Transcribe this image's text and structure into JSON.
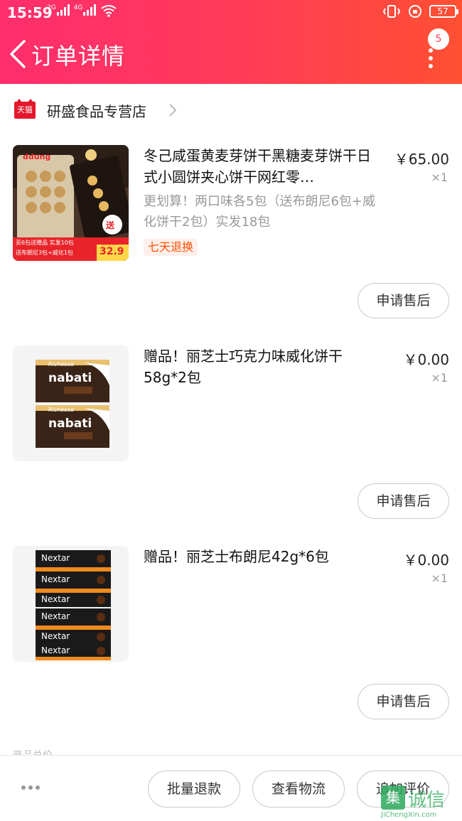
{
  "status_bar": {
    "time": "15:59",
    "signal_1": "2G",
    "signal_2": "4G",
    "battery": "57"
  },
  "header": {
    "title": "订单详情",
    "badge_count": "5"
  },
  "shop": {
    "name": "研盛食品专营店",
    "platform_logo_text": "天猫"
  },
  "items": [
    {
      "title": "冬己咸蛋黄麦芽饼干黑糖麦芽饼干日式小圆饼夹心饼干网红零…",
      "spec": "更划算！两口味各5包（送布朗尼6包+威化饼干2包）实发18包",
      "tag": "七天退换",
      "price": "￥65.00",
      "qty": "×1",
      "action": "申请售后",
      "thumb_text": {
        "brand": "ddung",
        "promo": "买6包送赠品 实发10包",
        "gift": "送布朗尼3包+威化1包",
        "price_label": "到手价:",
        "price": "32.9",
        "send": "送"
      }
    },
    {
      "title": "赠品！丽芝士巧克力味威化饼干58g*2包",
      "price": "￥0.00",
      "qty": "×1",
      "action": "申请售后",
      "thumb_text": {
        "brand": "Richeese",
        "product": "nabati"
      }
    },
    {
      "title": "赠品！丽芝士布朗尼42g*6包",
      "price": "￥0.00",
      "qty": "×1",
      "action": "申请售后",
      "thumb_text": {
        "product": "Nextar"
      }
    }
  ],
  "bottom_bar": {
    "peek_label": "商品总价",
    "buttons": [
      "批量退款",
      "查看物流",
      "追加评价"
    ]
  },
  "watermark": {
    "glyph": "集",
    "text": "诚信",
    "url": "JiChengXin.com"
  },
  "colors": {
    "header_start": "#ff2d6d",
    "header_end": "#ff5032",
    "tag_text": "#ff5000",
    "tmall_red": "#e5172c",
    "watermark_green": "#2faa5c"
  }
}
